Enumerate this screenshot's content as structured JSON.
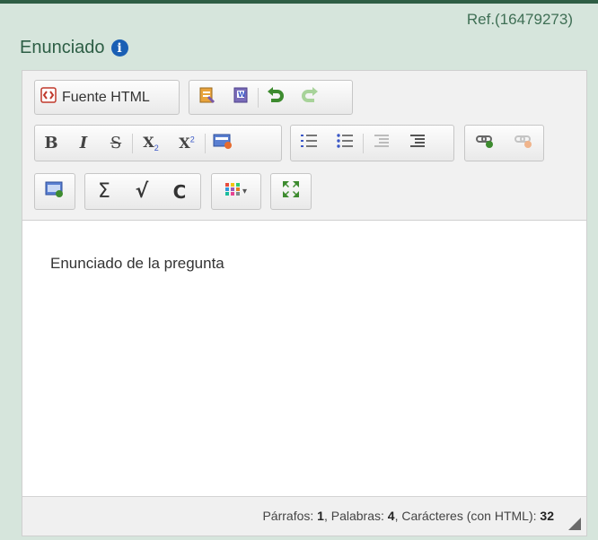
{
  "header": {
    "ref": "Ref.(16479273)",
    "label": "Enunciado",
    "info_icon_glyph": "i"
  },
  "toolbar": {
    "source_label": "Fuente HTML",
    "bold": "B",
    "italic": "I",
    "strike": "S",
    "subscript": "X",
    "subscript_mark": "2",
    "superscript": "X",
    "superscript_mark": "2",
    "sigma": "Σ",
    "sqrt": "√",
    "c_glyph": "C",
    "dropdown_caret": "▾",
    "icons": [
      "source-icon",
      "paste-text-icon",
      "paste-word-icon",
      "undo-icon",
      "redo-icon",
      "bold-icon",
      "italic-icon",
      "strike-icon",
      "subscript-icon",
      "superscript-icon",
      "html-icon",
      "numbered-list-icon",
      "bulleted-list-icon",
      "outdent-icon",
      "indent-icon",
      "link-icon",
      "unlink-icon",
      "image-icon",
      "sigma-icon",
      "sqrt-icon",
      "c-icon",
      "color-icon",
      "maximize-icon"
    ]
  },
  "content": {
    "text": "Enunciado de la pregunta"
  },
  "status": {
    "parrafos_label": "Párrafos: ",
    "parrafos": "1",
    "palabras_label": ", Palabras: ",
    "palabras": "4",
    "caracteres_label": ", Carácteres (con HTML): ",
    "caracteres": "32"
  },
  "colors": {
    "page_bg": "#d6e5dc",
    "label_green": "#2d5e45",
    "info_blue": "#1a5fb4"
  }
}
